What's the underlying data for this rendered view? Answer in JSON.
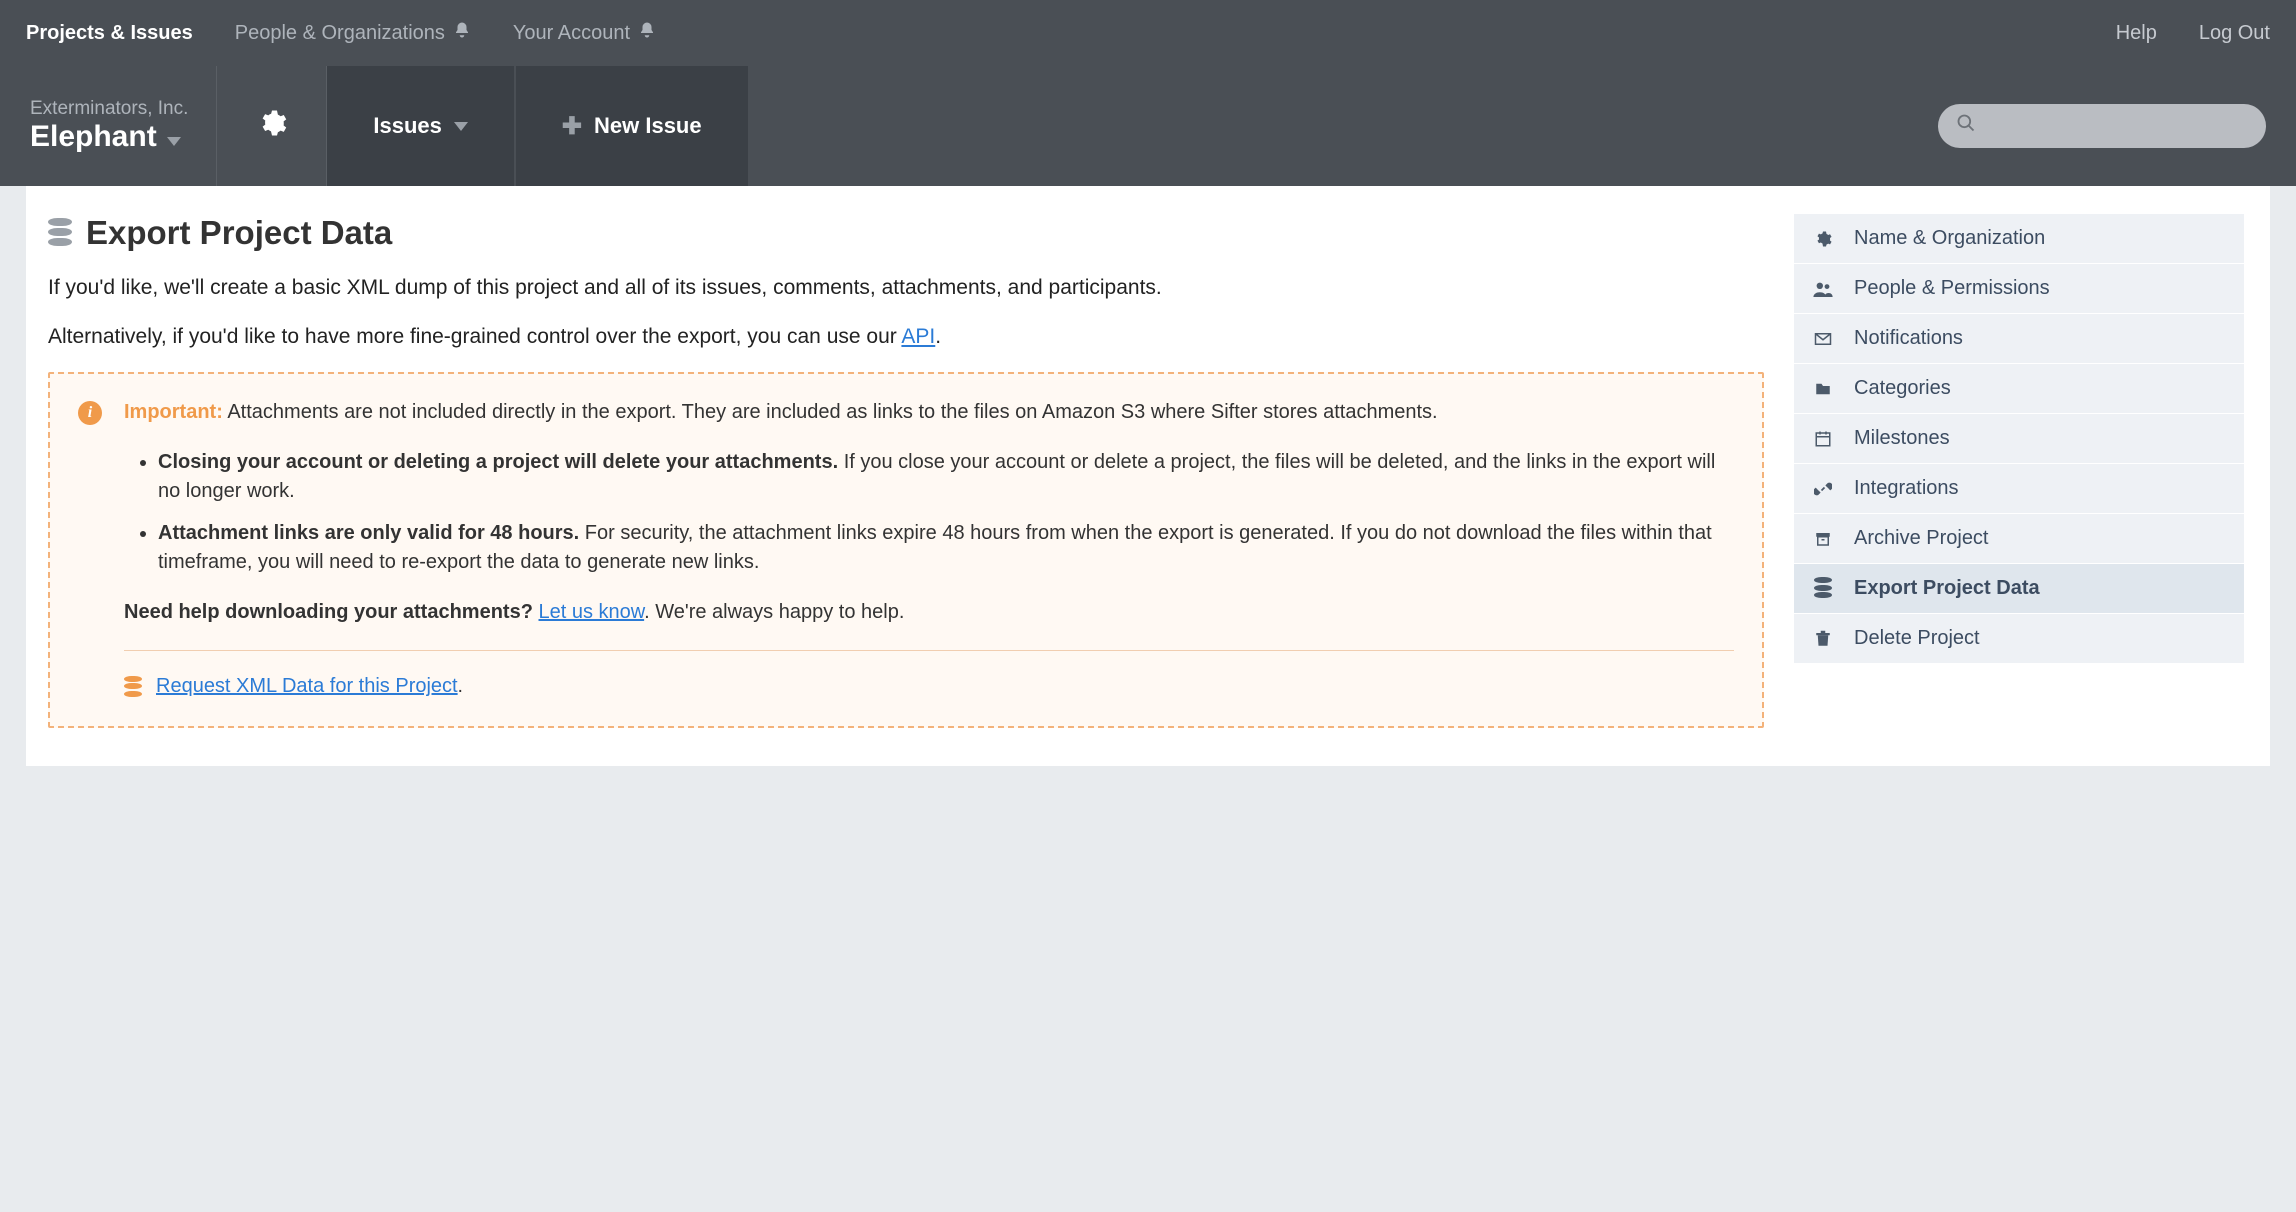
{
  "topnav": {
    "projects": "Projects & Issues",
    "people": "People & Organizations",
    "account": "Your Account",
    "help": "Help",
    "logout": "Log Out"
  },
  "project": {
    "org": "Exterminators, Inc.",
    "name": "Elephant",
    "issues_label": "Issues",
    "new_issue_label": "New Issue",
    "search_placeholder": ""
  },
  "page": {
    "title": "Export Project Data",
    "intro": "If you'd like, we'll create a basic XML dump of this project and all of its issues, comments, attachments, and participants.",
    "alt_prefix": "Alternatively, if you'd like to have more fine-grained control over the export, you can use our ",
    "api_link": "API",
    "alt_suffix": "."
  },
  "warn": {
    "important_label": "Important:",
    "intro_text": " Attachments are not included directly in the export. They are included as links to the files on Amazon S3 where Sifter stores attachments.",
    "bullet1_bold": "Closing your account or deleting a project will delete your attachments.",
    "bullet1_rest": " If you close your account or delete a project, the files will be deleted, and the links in the export will no longer work.",
    "bullet2_bold": "Attachment links are only valid for 48 hours.",
    "bullet2_rest": " For security, the attachment links expire 48 hours from when the export is generated. If you do not download the files within that timeframe, you will need to re-export the data to generate new links.",
    "need_help_bold": "Need help downloading your attachments?",
    "let_us_know": "Let us know",
    "need_help_rest": ". We're always happy to help.",
    "request_link": "Request XML Data for this Project",
    "request_suffix": "."
  },
  "sidebar": {
    "items": [
      {
        "label": "Name & Organization",
        "icon": "gear"
      },
      {
        "label": "People & Permissions",
        "icon": "people"
      },
      {
        "label": "Notifications",
        "icon": "mail"
      },
      {
        "label": "Categories",
        "icon": "folder"
      },
      {
        "label": "Milestones",
        "icon": "calendar"
      },
      {
        "label": "Integrations",
        "icon": "link"
      },
      {
        "label": "Archive Project",
        "icon": "archive"
      },
      {
        "label": "Export Project Data",
        "icon": "database",
        "active": true
      },
      {
        "label": "Delete Project",
        "icon": "trash"
      }
    ]
  }
}
